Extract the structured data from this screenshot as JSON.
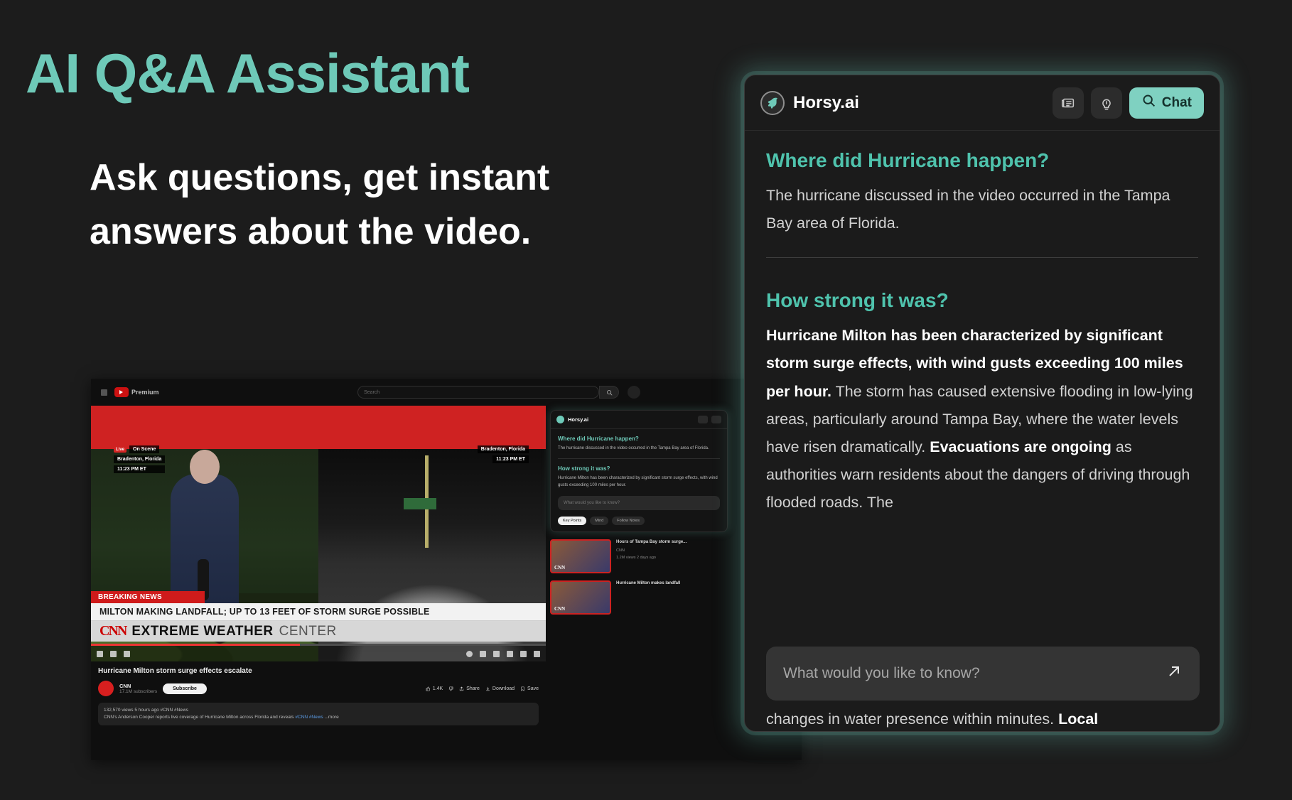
{
  "hero": {
    "title": "AI Q&A Assistant",
    "subtitle": "Ask questions, get instant answers about the video."
  },
  "colors": {
    "accent": "#6ec9b8",
    "accent_heading": "#4fc3ad",
    "chat_button_bg": "#7fd1c1",
    "page_bg": "#1c1c1c",
    "panel_bg": "#1b1b1b",
    "input_bg": "#343434",
    "body_text": "#d2d2d2",
    "news_red": "#cf1b1b"
  },
  "panel": {
    "brand": "Horsy.ai",
    "logo_icon": "horse-head-icon",
    "actions": {
      "article_icon": "article-icon",
      "idea_icon": "lightbulb-icon",
      "chat_label": "Chat",
      "chat_icon": "search-icon"
    },
    "qa": [
      {
        "question": "Where did Hurricane happen?",
        "answer_plain": "The hurricane discussed in the video occurred in the Tampa Bay area of Florida."
      },
      {
        "question": "How strong it was?",
        "answer_bold_1": "Hurricane Milton has been characterized by significant storm surge effects, with wind gusts exceeding 100 miles per hour.",
        "answer_mid": " The storm has caused extensive flooding in low-lying areas, particularly around Tampa Bay, where the water levels have risen dramatically. ",
        "answer_bold_2": "Evacuations are ongoing",
        "answer_tail": " as authorities warn residents about the dangers of driving through flooded roads. The"
      }
    ],
    "truncated_tail": "changes in water presence within minutes. Local",
    "truncated_tail_bold": "Local",
    "ask": {
      "placeholder": "What would you like to know?",
      "send_icon": "arrow-up-right-icon"
    }
  },
  "video": {
    "browser": {
      "menu_icon": "hamburger-icon",
      "logo_text": "Premium",
      "search_placeholder": "Search",
      "search_icon": "search-icon",
      "mic_icon": "microphone-icon",
      "avatar_icon": "avatar-icon"
    },
    "broadcast": {
      "live_tag": "Live",
      "on_scene": "On Scene",
      "location_left": "Bradenton, Florida",
      "time_left": "11:23 PM ET",
      "location_right": "Bradenton, Florida",
      "time_right": "11:23 PM ET",
      "breaking": "BREAKING NEWS",
      "headline": "MILTON MAKING LANDFALL; UP TO 13 FEET OF STORM SURGE POSSIBLE",
      "network": "CNN",
      "program_bold": "EXTREME WEATHER",
      "program_light": "CENTER"
    },
    "meta": {
      "title": "Hurricane Milton storm surge effects escalate",
      "channel": "CNN",
      "subscribers": "17.1M subscribers",
      "subscribe_label": "Subscribe",
      "likes": "1.4K",
      "dislike_icon": "thumbs-down-icon",
      "share_label": "Share",
      "download_label": "Download",
      "save_label": "Save",
      "views_line": "132,570 views  5 hours ago  #CNN #News",
      "desc_line": "CNN's Anderson Cooper reports live coverage of Hurricane Milton across Florida and reveals",
      "desc_link": "#CNN #News",
      "desc_more": "...more"
    },
    "mini_panel": {
      "brand": "Horsy.ai",
      "q1": "Where did Hurricane happen?",
      "a1": "The hurricane discussed in the video occurred in the Tampa Bay area of Florida.",
      "q2": "How strong it was?",
      "a2": "Hurricane Milton has been characterized by significant storm surge effects, with wind gusts exceeding 100 miles per hour.",
      "input_placeholder": "What would you like to know?",
      "tabs": [
        "Key Points",
        "Mind",
        "Follow Notes"
      ]
    },
    "related": {
      "title": "Hours of Tampa Bay storm surge...",
      "channel": "CNN",
      "stats": "1.2M views  2 days ago",
      "next_title": "Hurricane Milton makes landfall"
    }
  }
}
